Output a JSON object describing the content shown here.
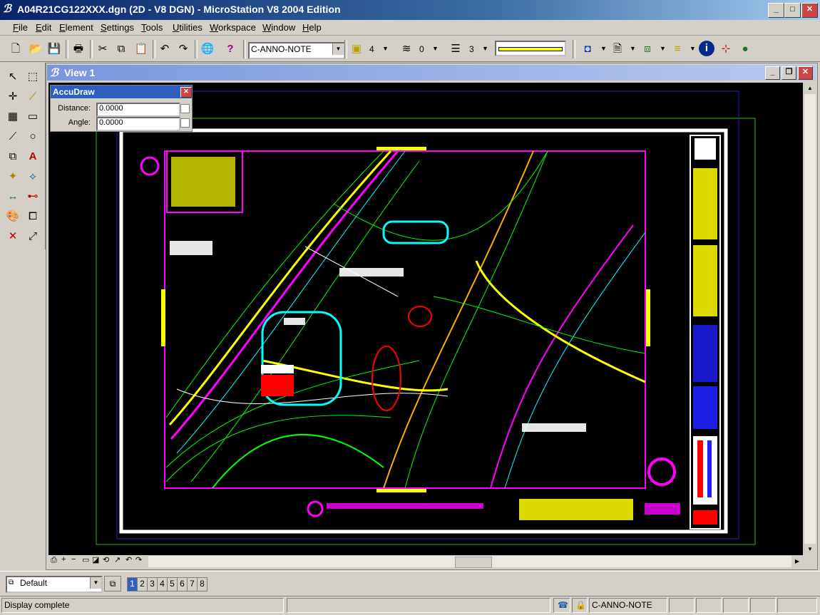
{
  "window": {
    "title": "A04R21CG122XXX.dgn (2D - V8 DGN) - MicroStation V8 2004 Edition"
  },
  "menu": [
    "File",
    "Edit",
    "Element",
    "Settings",
    "Tools",
    "Utilities",
    "Workspace",
    "Window",
    "Help"
  ],
  "toolbar": {
    "level": "C-ANNO-NOTE",
    "color_value": "4",
    "style_value": "0",
    "weight_value": "3",
    "active_color": "#ffff00"
  },
  "view": {
    "title": "View 1"
  },
  "accudraw": {
    "title": "AccuDraw",
    "distance_label": "Distance:",
    "distance_value": "0.0000",
    "angle_label": "Angle:",
    "angle_value": "0.0000"
  },
  "bottom": {
    "view_group": "Default",
    "view_numbers": [
      "1",
      "2",
      "3",
      "4",
      "5",
      "6",
      "7",
      "8"
    ],
    "selected_view": "1"
  },
  "status": {
    "message": "Display complete",
    "active_level": "C-ANNO-NOTE"
  }
}
